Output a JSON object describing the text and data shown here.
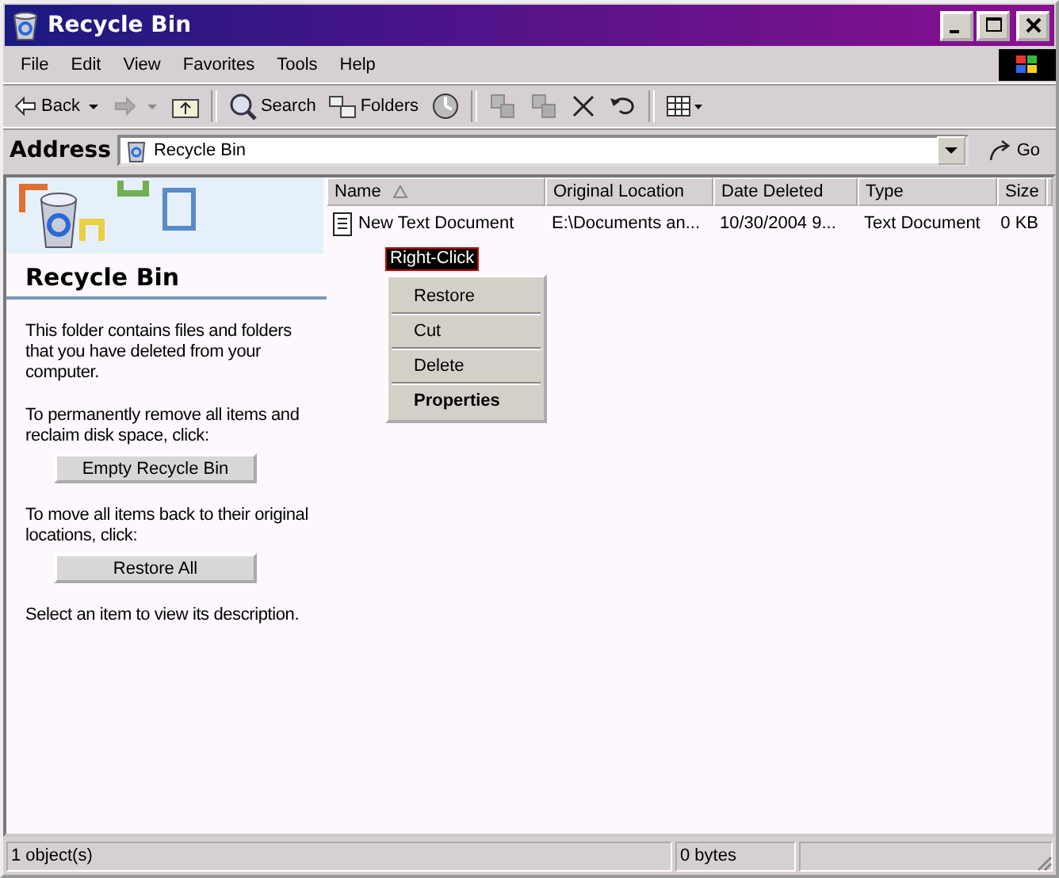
{
  "window": {
    "title": "Recycle Bin"
  },
  "menu": [
    "File",
    "Edit",
    "View",
    "Favorites",
    "Tools",
    "Help"
  ],
  "toolbar": [
    {
      "kind": "back",
      "label": "Back",
      "disabled": false
    },
    {
      "kind": "forward",
      "disabled": true
    },
    {
      "kind": "up",
      "disabled": false
    },
    {
      "kind": "separator"
    },
    {
      "kind": "search",
      "label": "Search",
      "disabled": false
    },
    {
      "kind": "folders",
      "label": "Folders",
      "disabled": false
    },
    {
      "kind": "history",
      "disabled": false
    },
    {
      "kind": "separator"
    },
    {
      "kind": "move",
      "disabled": true
    },
    {
      "kind": "copy",
      "disabled": true
    },
    {
      "kind": "delete",
      "disabled": false
    },
    {
      "kind": "undo",
      "disabled": false
    },
    {
      "kind": "separator"
    },
    {
      "kind": "views",
      "disabled": false
    }
  ],
  "address": {
    "label": "Address",
    "value": "Recycle Bin",
    "go": "Go"
  },
  "task_pane": {
    "title": "Recycle Bin",
    "description": "This folder contains files and folders that you have deleted from your computer.",
    "sections": [
      {
        "text": "To permanently remove all items and reclaim disk space, click:",
        "button": "Empty Recycle Bin"
      },
      {
        "text": "To move all items back to their original locations, click:",
        "button": "Restore All"
      }
    ],
    "footer": "Select an item to view its description."
  },
  "list": {
    "columns": [
      {
        "label": "Name",
        "sorted": true
      },
      {
        "label": "Original Location",
        "sorted": false
      },
      {
        "label": "Date Deleted",
        "sorted": false
      },
      {
        "label": "Type",
        "sorted": false
      },
      {
        "label": "Size",
        "sorted": false
      }
    ],
    "rows": [
      {
        "cells": [
          "New Text Document",
          "E:\\Documents an...",
          "10/30/2004 9...",
          "Text Document",
          "0 KB"
        ]
      }
    ]
  },
  "context_menu": {
    "callout": "Right-Click",
    "items": [
      {
        "label": "Restore",
        "default": false
      },
      {
        "label": "Cut",
        "default": false
      },
      {
        "label": "Delete",
        "default": false
      },
      {
        "label": "Properties",
        "default": true
      }
    ]
  },
  "status_bar": [
    "1 object(s)",
    "0 bytes"
  ]
}
